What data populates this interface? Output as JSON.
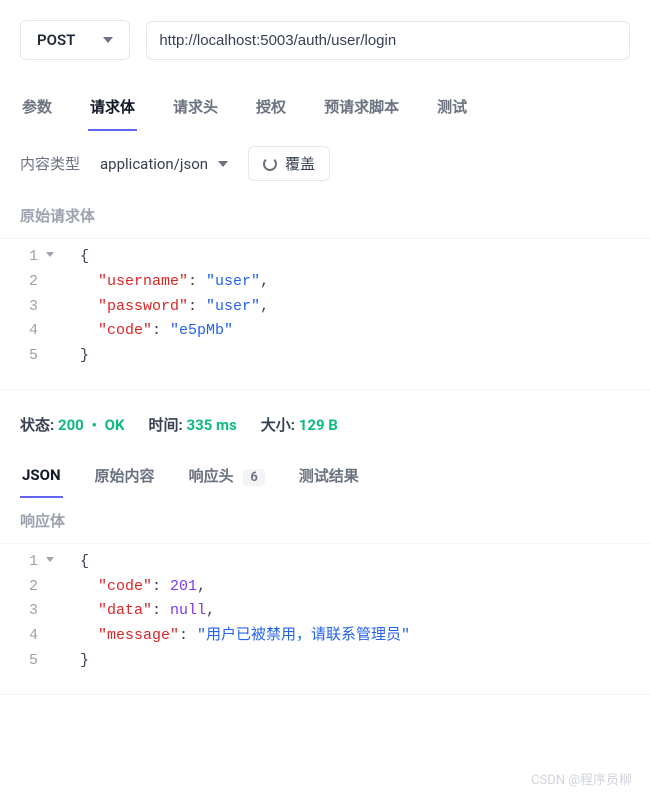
{
  "request": {
    "method": "POST",
    "url": "http://localhost:5003/auth/user/login"
  },
  "tabs": {
    "params": "参数",
    "body": "请求体",
    "headers": "请求头",
    "auth": "授权",
    "prerequest": "预请求脚本",
    "tests": "测试"
  },
  "content_type": {
    "label": "内容类型",
    "value": "application/json",
    "override": "覆盖"
  },
  "raw_body_label": "原始请求体",
  "request_body": {
    "l1": "{",
    "l2_key": "\"username\"",
    "l2_val": "\"user\"",
    "l3_key": "\"password\"",
    "l3_val": "\"user\"",
    "l4_key": "\"code\"",
    "l4_val": "\"e5pMb\"",
    "l5": "}"
  },
  "status": {
    "status_label": "状态:",
    "code": "200",
    "text": "OK",
    "time_label": "时间:",
    "time_value": "335 ms",
    "size_label": "大小:",
    "size_value": "129 B"
  },
  "resp_tabs": {
    "json": "JSON",
    "raw": "原始内容",
    "headers": "响应头",
    "headers_count": "6",
    "tests": "测试结果"
  },
  "resp_body_label": "响应体",
  "response_body": {
    "l1": "{",
    "l2_key": "\"code\"",
    "l2_val": "201",
    "l3_key": "\"data\"",
    "l3_val": "null",
    "l4_key": "\"message\"",
    "l4_val": "\"用户已被禁用，请联系管理员\"",
    "l5": "}"
  },
  "line_numbers": {
    "n1": "1",
    "n2": "2",
    "n3": "3",
    "n4": "4",
    "n5": "5"
  },
  "punct": {
    "colon": ": ",
    "comma": ","
  },
  "watermark": "CSDN @程序员柳"
}
